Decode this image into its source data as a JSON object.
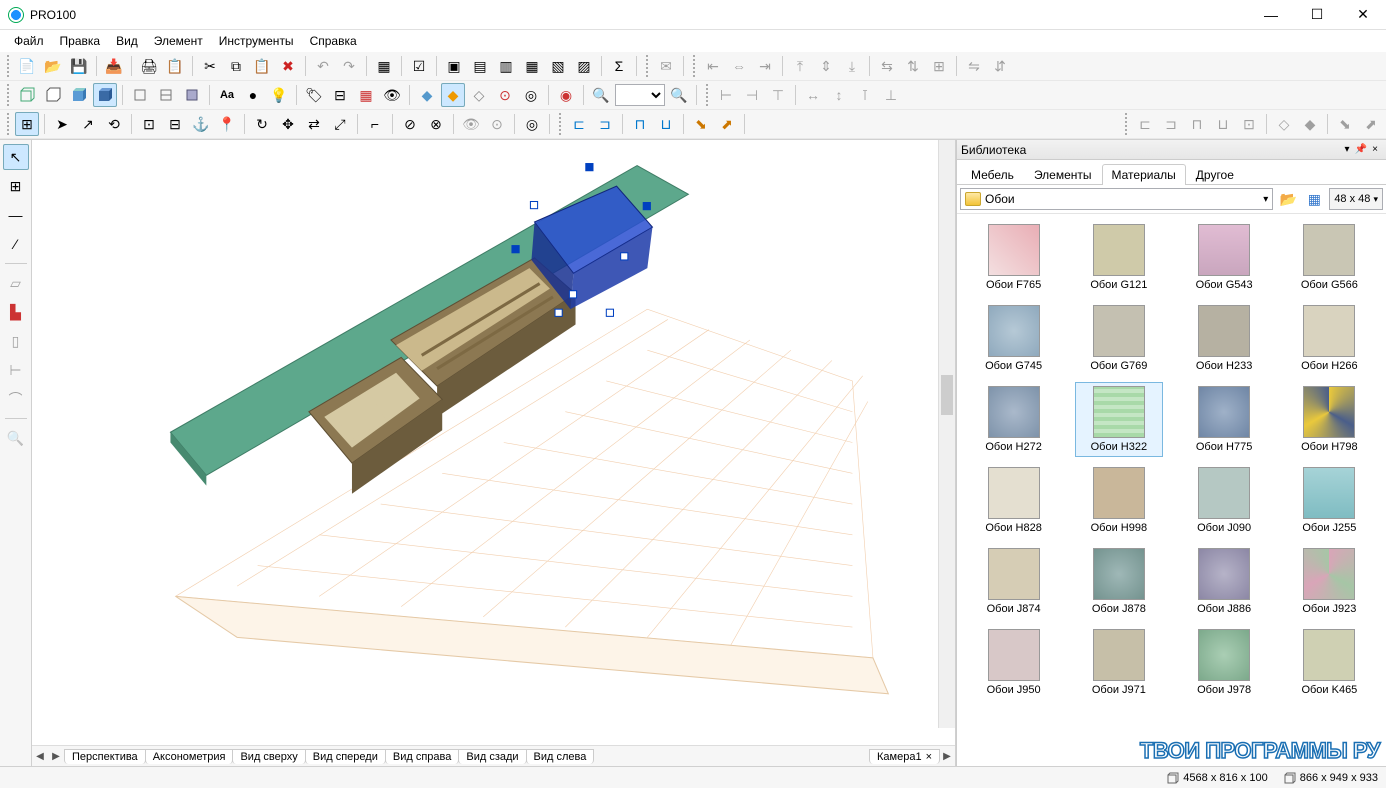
{
  "window": {
    "title": "PRO100"
  },
  "menu": [
    "Файл",
    "Правка",
    "Вид",
    "Элемент",
    "Инструменты",
    "Справка"
  ],
  "library": {
    "title": "Библиотека",
    "tabs": [
      "Мебель",
      "Элементы",
      "Материалы",
      "Другое"
    ],
    "active_tab": 2,
    "path": "Обои",
    "thumb_size": "48 x  48",
    "items": [
      {
        "label": "Обои F765",
        "bg": "linear-gradient(45deg,#f3dfe0,#e9aeb5)"
      },
      {
        "label": "Обои G121",
        "bg": "#cfcaa9"
      },
      {
        "label": "Обои G543",
        "bg": "linear-gradient(#e1bcd3,#c9a6be)"
      },
      {
        "label": "Обои G566",
        "bg": "#c9c6b4"
      },
      {
        "label": "Обои G745",
        "bg": "radial-gradient(#b6c9d6,#8fa9bd)"
      },
      {
        "label": "Обои G769",
        "bg": "#c4c0b1"
      },
      {
        "label": "Обои H233",
        "bg": "#b6b1a2"
      },
      {
        "label": "Обои H266",
        "bg": "#d9d3bf"
      },
      {
        "label": "Обои H272",
        "bg": "radial-gradient(#aab9cb,#7e93aa)"
      },
      {
        "label": "Обои H322",
        "bg": "repeating-linear-gradient(0deg,#a8d9a8 0 4px,#c4e6c4 4px 8px)",
        "selected": true
      },
      {
        "label": "Обои H775",
        "bg": "radial-gradient(#9fb1c8,#6f86a5)"
      },
      {
        "label": "Обои H798",
        "bg": "conic-gradient(#eac93c,#4a5e8a,#eac93c,#4a5e8a)"
      },
      {
        "label": "Обои H828",
        "bg": "#e4dfd0"
      },
      {
        "label": "Обои H998",
        "bg": "#c9b79a"
      },
      {
        "label": "Обои J090",
        "bg": "#b5c8c3"
      },
      {
        "label": "Обои J255",
        "bg": "linear-gradient(#a6d3d7,#7fbcc2)"
      },
      {
        "label": "Обои J874",
        "bg": "#d6cdb5"
      },
      {
        "label": "Обои J878",
        "bg": "radial-gradient(#9fb8b7,#74938f)"
      },
      {
        "label": "Обои J886",
        "bg": "radial-gradient(#b6b3c8,#8c87a5)"
      },
      {
        "label": "Обои J923",
        "bg": "conic-gradient(#d9a5b8,#a6c6a6,#d9a5b8,#a6c6a6)"
      },
      {
        "label": "Обои J950",
        "bg": "#d8c8c8"
      },
      {
        "label": "Обои J971",
        "bg": "#c6bfa8"
      },
      {
        "label": "Обои J978",
        "bg": "radial-gradient(#aaceb4,#7ca98b)"
      },
      {
        "label": "Обои K465",
        "bg": "#cfd0b3"
      }
    ]
  },
  "view_tabs": [
    "Перспектива",
    "Аксонометрия",
    "Вид сверху",
    "Вид спереди",
    "Вид справа",
    "Вид сзади",
    "Вид слева"
  ],
  "camera_tab": "Камера1",
  "status": {
    "dim1": "4568 x 816 x 100",
    "dim2": "866 x 949 x 933"
  },
  "watermark": "ТВОИ ПРОГРАММЫ РУ"
}
